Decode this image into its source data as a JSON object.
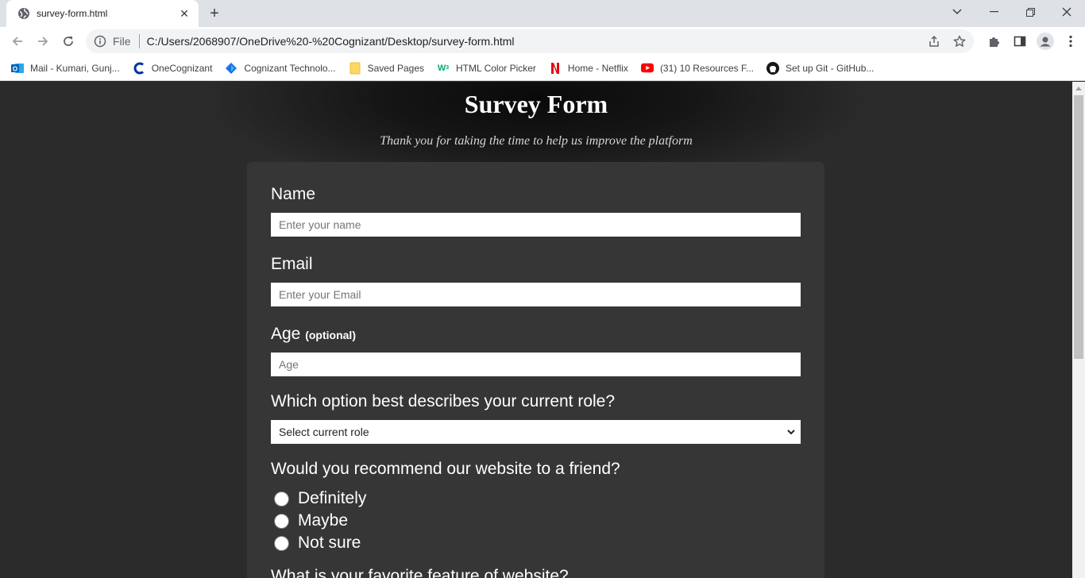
{
  "browser": {
    "tab_title": "survey-form.html",
    "omnibox_scheme": "File",
    "url": "C:/Users/2068907/OneDrive%20-%20Cognizant/Desktop/survey-form.html",
    "bookmarks": [
      {
        "label": "Mail - Kumari, Gunj...",
        "icon": "outlook-icon"
      },
      {
        "label": "OneCognizant",
        "icon": "cognizant-c-icon"
      },
      {
        "label": "Cognizant Technolo...",
        "icon": "cognizant-diamond-icon"
      },
      {
        "label": "Saved Pages",
        "icon": "folder-icon"
      },
      {
        "label": "HTML Color Picker",
        "icon": "w3schools-icon"
      },
      {
        "label": "Home - Netflix",
        "icon": "netflix-icon"
      },
      {
        "label": "(31) 10 Resources F...",
        "icon": "youtube-icon"
      },
      {
        "label": "Set up Git - GitHub...",
        "icon": "github-icon"
      }
    ]
  },
  "page": {
    "title": "Survey Form",
    "description": "Thank you for taking the time to help us improve the platform"
  },
  "form": {
    "name": {
      "label": "Name",
      "placeholder": "Enter your name"
    },
    "email": {
      "label": "Email",
      "placeholder": "Enter your Email"
    },
    "age": {
      "label": "Age",
      "note": "(optional)",
      "placeholder": "Age"
    },
    "role": {
      "label": "Which option best describes your current role?",
      "selected": "Select current role"
    },
    "recommend": {
      "label": "Would you recommend our website to a friend?",
      "options": [
        "Definitely",
        "Maybe",
        "Not sure"
      ]
    },
    "feature": {
      "label": "What is your favorite feature of website?"
    }
  },
  "colors": {
    "page_bg": "#2b2b2b",
    "form_bg": "#363636",
    "text": "#ffffff"
  }
}
